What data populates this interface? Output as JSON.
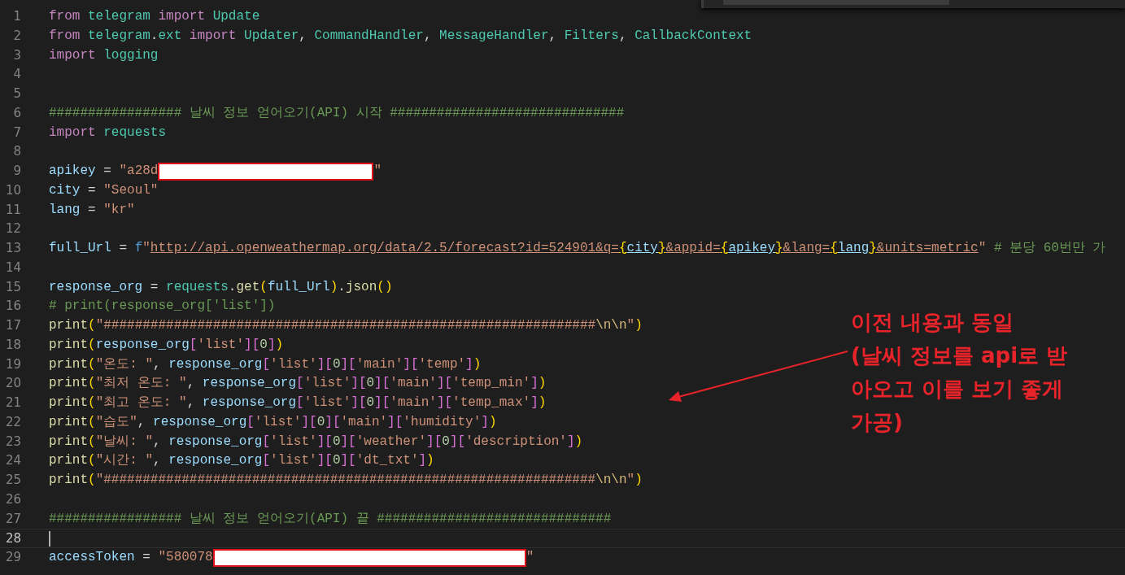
{
  "editor": {
    "lines": [
      {
        "number": "1",
        "current": false,
        "tokens": [
          {
            "kind": "keyword",
            "text": "from "
          },
          {
            "kind": "module",
            "text": "telegram "
          },
          {
            "kind": "keyword",
            "text": "import "
          },
          {
            "kind": "class",
            "text": "Update"
          }
        ]
      },
      {
        "number": "2",
        "current": false,
        "tokens": [
          {
            "kind": "keyword",
            "text": "from "
          },
          {
            "kind": "module",
            "text": "telegram"
          },
          {
            "kind": "plain",
            "text": "."
          },
          {
            "kind": "module",
            "text": "ext "
          },
          {
            "kind": "keyword",
            "text": "import "
          },
          {
            "kind": "class",
            "text": "Updater"
          },
          {
            "kind": "plain",
            "text": ", "
          },
          {
            "kind": "class",
            "text": "CommandHandler"
          },
          {
            "kind": "plain",
            "text": ", "
          },
          {
            "kind": "class",
            "text": "MessageHandler"
          },
          {
            "kind": "plain",
            "text": ", "
          },
          {
            "kind": "class",
            "text": "Filters"
          },
          {
            "kind": "plain",
            "text": ", "
          },
          {
            "kind": "class",
            "text": "CallbackContext"
          }
        ]
      },
      {
        "number": "3",
        "current": false,
        "tokens": [
          {
            "kind": "keyword",
            "text": "import "
          },
          {
            "kind": "module",
            "text": "logging"
          }
        ]
      },
      {
        "number": "4",
        "current": false
      },
      {
        "number": "5",
        "current": false
      },
      {
        "number": "6",
        "current": false,
        "tokens": [
          {
            "kind": "comment",
            "text": "################# 날씨 정보 얻어오기(API) 시작 ##############################"
          }
        ]
      },
      {
        "number": "7",
        "current": false,
        "tokens": [
          {
            "kind": "keyword",
            "text": "import "
          },
          {
            "kind": "module",
            "text": "requests"
          }
        ]
      },
      {
        "number": "8",
        "current": false
      },
      {
        "number": "9",
        "current": false,
        "tokens": [
          {
            "kind": "variable",
            "text": "apikey"
          },
          {
            "kind": "plain",
            "text": " = "
          },
          {
            "kind": "string",
            "text": "\"a28d"
          },
          {
            "kind": "redaction"
          },
          {
            "kind": "string",
            "text": "\""
          }
        ]
      },
      {
        "number": "10",
        "current": false,
        "tokens": [
          {
            "kind": "variable",
            "text": "city"
          },
          {
            "kind": "plain",
            "text": " = "
          },
          {
            "kind": "string",
            "text": "\"Seoul\""
          }
        ]
      },
      {
        "number": "11",
        "current": false,
        "tokens": [
          {
            "kind": "variable",
            "text": "lang"
          },
          {
            "kind": "plain",
            "text": " = "
          },
          {
            "kind": "string",
            "text": "\"kr\""
          }
        ]
      },
      {
        "number": "12",
        "current": false
      },
      {
        "number": "13",
        "current": false,
        "tokens": [
          {
            "kind": "variable",
            "text": "full_Url"
          },
          {
            "kind": "plain",
            "text": " = "
          },
          {
            "kind": "storage",
            "text": "f"
          },
          {
            "kind": "string",
            "text": "\""
          },
          {
            "kind": "url",
            "text": "http://api.openweathermap.org/data/2.5/forecast?id=524901&q="
          },
          {
            "kind": "url-brace",
            "text": "{"
          },
          {
            "kind": "url-variable",
            "text": "city"
          },
          {
            "kind": "url-brace",
            "text": "}"
          },
          {
            "kind": "url",
            "text": "&appid="
          },
          {
            "kind": "url-brace",
            "text": "{"
          },
          {
            "kind": "url-variable",
            "text": "apikey"
          },
          {
            "kind": "url-brace",
            "text": "}"
          },
          {
            "kind": "url",
            "text": "&lang="
          },
          {
            "kind": "url-brace",
            "text": "{"
          },
          {
            "kind": "url-variable",
            "text": "lang"
          },
          {
            "kind": "url-brace",
            "text": "}"
          },
          {
            "kind": "url",
            "text": "&units=metric"
          },
          {
            "kind": "string",
            "text": "\" "
          },
          {
            "kind": "comment",
            "text": "# 분당 60번만 가"
          }
        ]
      },
      {
        "number": "14",
        "current": false
      },
      {
        "number": "15",
        "current": false,
        "tokens": [
          {
            "kind": "variable",
            "text": "response_org"
          },
          {
            "kind": "plain",
            "text": " = "
          },
          {
            "kind": "module",
            "text": "requests"
          },
          {
            "kind": "plain",
            "text": "."
          },
          {
            "kind": "function",
            "text": "get"
          },
          {
            "kind": "paren",
            "text": "("
          },
          {
            "kind": "variable",
            "text": "full_Url"
          },
          {
            "kind": "paren",
            "text": ")"
          },
          {
            "kind": "plain",
            "text": "."
          },
          {
            "kind": "function",
            "text": "json"
          },
          {
            "kind": "paren",
            "text": "()"
          }
        ]
      },
      {
        "number": "16",
        "current": false,
        "tokens": [
          {
            "kind": "comment",
            "text": "# print(response_org['list'])"
          }
        ]
      },
      {
        "number": "17",
        "current": false,
        "tokens": [
          {
            "kind": "function",
            "text": "print"
          },
          {
            "kind": "paren",
            "text": "("
          },
          {
            "kind": "string",
            "text": "\"###############################################################"
          },
          {
            "kind": "escape",
            "text": "\\n\\n"
          },
          {
            "kind": "string",
            "text": "\""
          },
          {
            "kind": "paren",
            "text": ")"
          }
        ]
      },
      {
        "number": "18",
        "current": false,
        "tokens": [
          {
            "kind": "function",
            "text": "print"
          },
          {
            "kind": "paren",
            "text": "("
          },
          {
            "kind": "variable",
            "text": "response_org"
          },
          {
            "kind": "bracket",
            "text": "["
          },
          {
            "kind": "string",
            "text": "'list'"
          },
          {
            "kind": "bracket",
            "text": "]["
          },
          {
            "kind": "number",
            "text": "0"
          },
          {
            "kind": "bracket",
            "text": "]"
          },
          {
            "kind": "paren",
            "text": ")"
          }
        ]
      },
      {
        "number": "19",
        "current": false,
        "tokens": [
          {
            "kind": "function",
            "text": "print"
          },
          {
            "kind": "paren",
            "text": "("
          },
          {
            "kind": "string",
            "text": "\"온도: \""
          },
          {
            "kind": "plain",
            "text": ", "
          },
          {
            "kind": "variable",
            "text": "response_org"
          },
          {
            "kind": "bracket",
            "text": "["
          },
          {
            "kind": "string",
            "text": "'list'"
          },
          {
            "kind": "bracket",
            "text": "]["
          },
          {
            "kind": "number",
            "text": "0"
          },
          {
            "kind": "bracket",
            "text": "]["
          },
          {
            "kind": "string",
            "text": "'main'"
          },
          {
            "kind": "bracket",
            "text": "]["
          },
          {
            "kind": "string",
            "text": "'temp'"
          },
          {
            "kind": "bracket",
            "text": "]"
          },
          {
            "kind": "paren",
            "text": ")"
          }
        ]
      },
      {
        "number": "20",
        "current": false,
        "tokens": [
          {
            "kind": "function",
            "text": "print"
          },
          {
            "kind": "paren",
            "text": "("
          },
          {
            "kind": "string",
            "text": "\"최저 온도: \""
          },
          {
            "kind": "plain",
            "text": ", "
          },
          {
            "kind": "variable",
            "text": "response_org"
          },
          {
            "kind": "bracket",
            "text": "["
          },
          {
            "kind": "string",
            "text": "'list'"
          },
          {
            "kind": "bracket",
            "text": "]["
          },
          {
            "kind": "number",
            "text": "0"
          },
          {
            "kind": "bracket",
            "text": "]["
          },
          {
            "kind": "string",
            "text": "'main'"
          },
          {
            "kind": "bracket",
            "text": "]["
          },
          {
            "kind": "string",
            "text": "'temp_min'"
          },
          {
            "kind": "bracket",
            "text": "]"
          },
          {
            "kind": "paren",
            "text": ")"
          }
        ]
      },
      {
        "number": "21",
        "current": false,
        "tokens": [
          {
            "kind": "function",
            "text": "print"
          },
          {
            "kind": "paren",
            "text": "("
          },
          {
            "kind": "string",
            "text": "\"최고 온도: \""
          },
          {
            "kind": "plain",
            "text": ", "
          },
          {
            "kind": "variable",
            "text": "response_org"
          },
          {
            "kind": "bracket",
            "text": "["
          },
          {
            "kind": "string",
            "text": "'list'"
          },
          {
            "kind": "bracket",
            "text": "]["
          },
          {
            "kind": "number",
            "text": "0"
          },
          {
            "kind": "bracket",
            "text": "]["
          },
          {
            "kind": "string",
            "text": "'main'"
          },
          {
            "kind": "bracket",
            "text": "]["
          },
          {
            "kind": "string",
            "text": "'temp_max'"
          },
          {
            "kind": "bracket",
            "text": "]"
          },
          {
            "kind": "paren",
            "text": ")"
          }
        ]
      },
      {
        "number": "22",
        "current": false,
        "tokens": [
          {
            "kind": "function",
            "text": "print"
          },
          {
            "kind": "paren",
            "text": "("
          },
          {
            "kind": "string",
            "text": "\"습도\""
          },
          {
            "kind": "plain",
            "text": ", "
          },
          {
            "kind": "variable",
            "text": "response_org"
          },
          {
            "kind": "bracket",
            "text": "["
          },
          {
            "kind": "string",
            "text": "'list'"
          },
          {
            "kind": "bracket",
            "text": "]["
          },
          {
            "kind": "number",
            "text": "0"
          },
          {
            "kind": "bracket",
            "text": "]["
          },
          {
            "kind": "string",
            "text": "'main'"
          },
          {
            "kind": "bracket",
            "text": "]["
          },
          {
            "kind": "string",
            "text": "'humidity'"
          },
          {
            "kind": "bracket",
            "text": "]"
          },
          {
            "kind": "paren",
            "text": ")"
          }
        ]
      },
      {
        "number": "23",
        "current": false,
        "tokens": [
          {
            "kind": "function",
            "text": "print"
          },
          {
            "kind": "paren",
            "text": "("
          },
          {
            "kind": "string",
            "text": "\"날씨: \""
          },
          {
            "kind": "plain",
            "text": ", "
          },
          {
            "kind": "variable",
            "text": "response_org"
          },
          {
            "kind": "bracket",
            "text": "["
          },
          {
            "kind": "string",
            "text": "'list'"
          },
          {
            "kind": "bracket",
            "text": "]["
          },
          {
            "kind": "number",
            "text": "0"
          },
          {
            "kind": "bracket",
            "text": "]["
          },
          {
            "kind": "string",
            "text": "'weather'"
          },
          {
            "kind": "bracket",
            "text": "]["
          },
          {
            "kind": "number",
            "text": "0"
          },
          {
            "kind": "bracket",
            "text": "]["
          },
          {
            "kind": "string",
            "text": "'description'"
          },
          {
            "kind": "bracket",
            "text": "]"
          },
          {
            "kind": "paren",
            "text": ")"
          }
        ]
      },
      {
        "number": "24",
        "current": false,
        "tokens": [
          {
            "kind": "function",
            "text": "print"
          },
          {
            "kind": "paren",
            "text": "("
          },
          {
            "kind": "string",
            "text": "\"시간: \""
          },
          {
            "kind": "plain",
            "text": ", "
          },
          {
            "kind": "variable",
            "text": "response_org"
          },
          {
            "kind": "bracket",
            "text": "["
          },
          {
            "kind": "string",
            "text": "'list'"
          },
          {
            "kind": "bracket",
            "text": "]["
          },
          {
            "kind": "number",
            "text": "0"
          },
          {
            "kind": "bracket",
            "text": "]["
          },
          {
            "kind": "string",
            "text": "'dt_txt'"
          },
          {
            "kind": "bracket",
            "text": "]"
          },
          {
            "kind": "paren",
            "text": ")"
          }
        ]
      },
      {
        "number": "25",
        "current": false,
        "tokens": [
          {
            "kind": "function",
            "text": "print"
          },
          {
            "kind": "paren",
            "text": "("
          },
          {
            "kind": "string",
            "text": "\"###############################################################"
          },
          {
            "kind": "escape",
            "text": "\\n\\n"
          },
          {
            "kind": "string",
            "text": "\""
          },
          {
            "kind": "paren",
            "text": ")"
          }
        ]
      },
      {
        "number": "26",
        "current": false
      },
      {
        "number": "27",
        "current": false,
        "tokens": [
          {
            "kind": "comment",
            "text": "################# 날씨 정보 얻어오기(API) 끝 ##############################"
          }
        ]
      },
      {
        "number": "28",
        "current": true
      },
      {
        "number": "29",
        "current": false,
        "tokens": [
          {
            "kind": "variable",
            "text": "accessToken"
          },
          {
            "kind": "plain",
            "text": " = "
          },
          {
            "kind": "string",
            "text": "\"580078"
          },
          {
            "kind": "redaction"
          },
          {
            "kind": "string",
            "text": "\""
          }
        ]
      }
    ]
  },
  "annotation": {
    "lines": [
      "이전 내용과 동일",
      "(날씨 정보를 api로 받",
      "아오고 이를 보기 좋게",
      "가공)"
    ]
  }
}
